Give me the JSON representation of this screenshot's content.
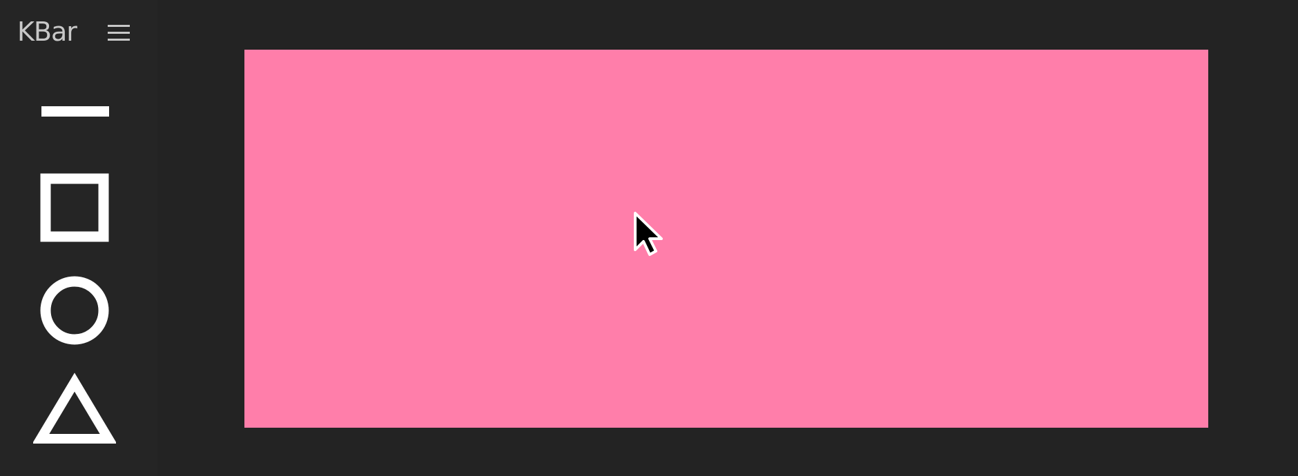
{
  "app": {
    "title": "KBar",
    "colors": {
      "background": "#232323",
      "sidebar": "#252525",
      "canvas_fill": "#ff7eaa",
      "tool_stroke": "#ffffff",
      "title_text": "#c8c8c8"
    }
  },
  "toolbar": {
    "menu_icon": "hamburger-menu-icon",
    "tools": [
      {
        "name": "line",
        "icon": "line-tool-icon"
      },
      {
        "name": "rectangle",
        "icon": "rectangle-tool-icon"
      },
      {
        "name": "ellipse",
        "icon": "ellipse-tool-icon"
      },
      {
        "name": "triangle",
        "icon": "triangle-tool-icon"
      }
    ]
  },
  "canvas": {
    "shape": "rectangle",
    "fill": "#ff7eaa",
    "cursor_icon": "arrow-pointer-icon"
  }
}
